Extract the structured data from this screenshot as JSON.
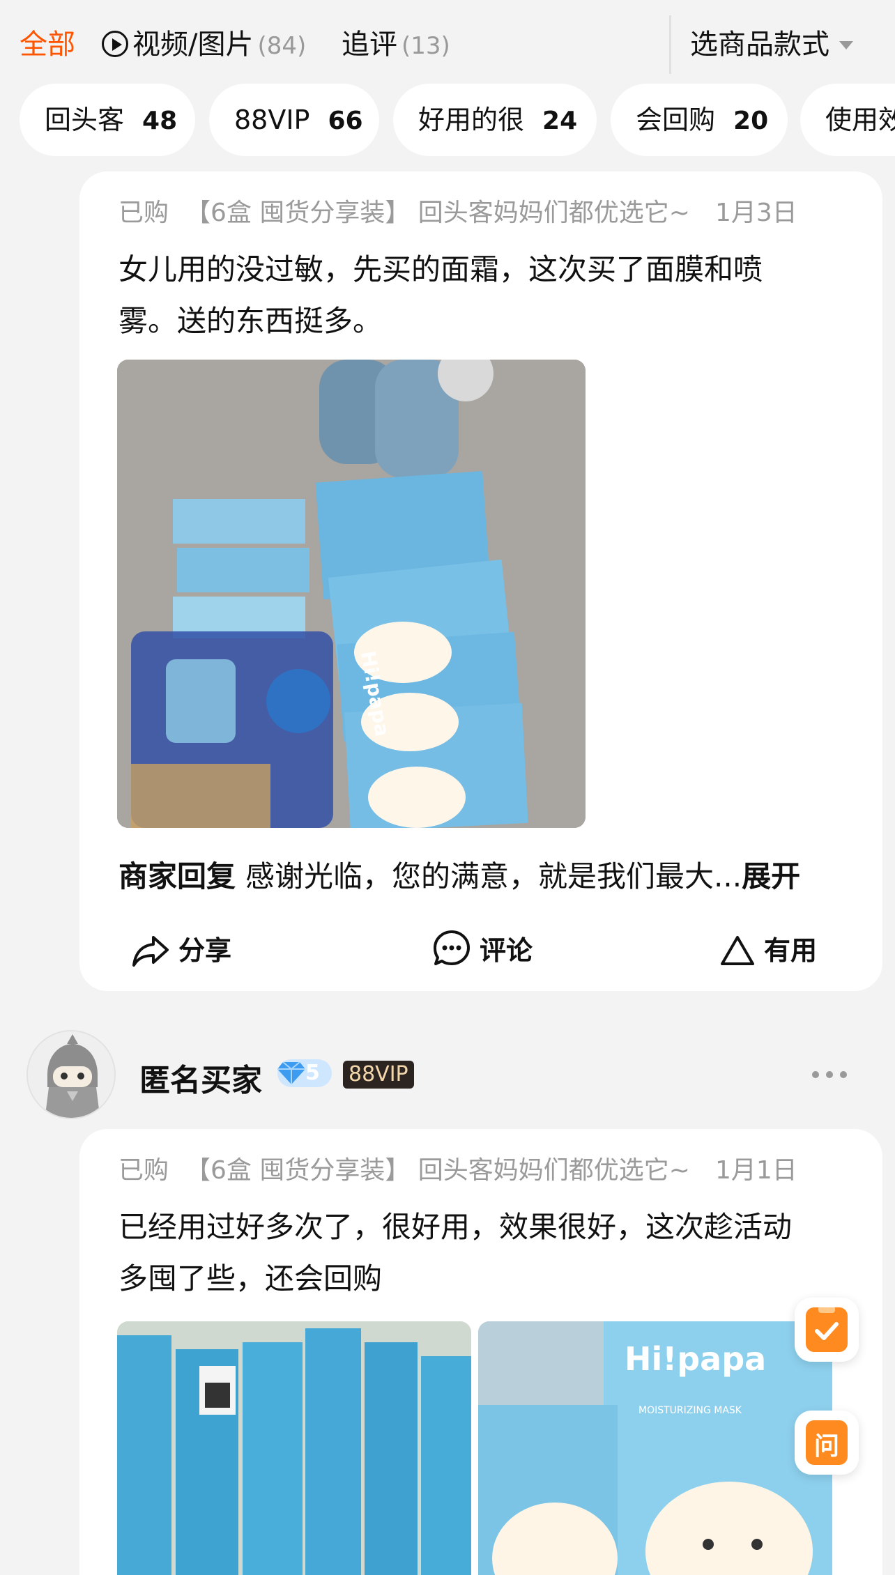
{
  "tabs": {
    "all_label": "全部",
    "media_label": "视频/图片",
    "media_count": "(84)",
    "followup_label": "追评",
    "followup_count": "(13)",
    "sku_select_label": "选商品款式"
  },
  "chips": [
    {
      "label": "回头客",
      "count": "48"
    },
    {
      "label": "88VIP",
      "count": "66"
    },
    {
      "label": "好用的很",
      "count": "24"
    },
    {
      "label": "会回购",
      "count": "20"
    },
    {
      "label": "使用效"
    }
  ],
  "reviews": [
    {
      "purchased": "已购",
      "sku": "【6盒 囤货分享装】 回头客妈妈们都优选它~",
      "date": "1月3日",
      "content": "女儿用的没过敏，先买的面霜，这次买了面膜和喷雾。送的东西挺多。",
      "merchant_reply_title": "商家回复",
      "merchant_reply_text": "感谢光临，您的满意，就是我们最大...",
      "expand_label": "展开",
      "share_label": "分享",
      "comment_label": "评论",
      "useful_label": "有用"
    },
    {
      "user": "匿名买家",
      "level": "5",
      "vip": "88VIP",
      "purchased": "已购",
      "sku": "【6盒 囤货分享装】 回头客妈妈们都优选它~",
      "date": "1月1日",
      "content": "已经用过好多次了，很好用，效果很好，这次趁活动多囤了些，还会回购"
    }
  ],
  "photo_brand": "Hi!papa",
  "photo_caption": "MOISTURIZING MASK",
  "float": {
    "ask_label": "问"
  },
  "colors": {
    "accent": "#ff5500",
    "float_orange": "#ff8a1f",
    "page_bg": "#f3f3f3"
  },
  "icons": [
    "play-circle-icon",
    "chevron-down-icon",
    "share-icon",
    "comment-icon",
    "useful-icon",
    "diamond-icon",
    "more-icon",
    "checklist-icon",
    "ask-icon"
  ]
}
